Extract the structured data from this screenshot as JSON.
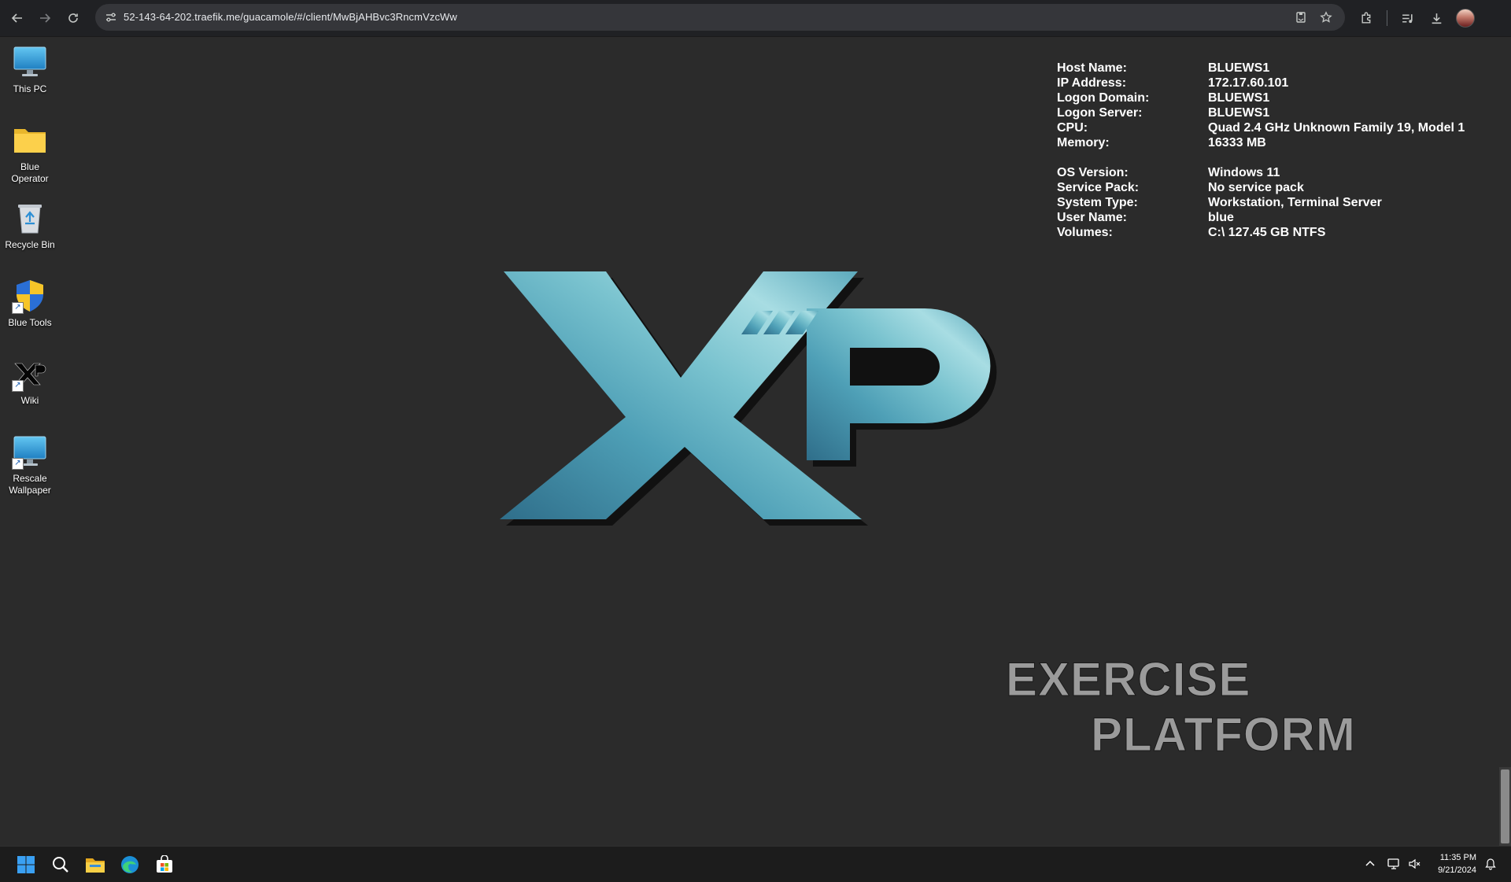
{
  "browser": {
    "url": "52-143-64-202.traefik.me/guacamole/#/client/MwBjAHBvc3RncmVzcWw",
    "icons": [
      "back-icon",
      "forward-icon",
      "reload-icon",
      "site-info-icon",
      "install-app-icon",
      "bookmark-star-icon",
      "extensions-icon",
      "media-control-icon",
      "downloads-icon",
      "profile-avatar"
    ]
  },
  "desktop": {
    "icons": [
      {
        "label": "This PC"
      },
      {
        "label": "Blue\nOperator"
      },
      {
        "label": "Recycle Bin"
      },
      {
        "label": "Blue Tools"
      },
      {
        "label": "Wiki"
      },
      {
        "label": "Rescale\nWallpaper"
      }
    ]
  },
  "sysinfo": {
    "group1": [
      {
        "key": "Host Name:",
        "value": "BLUEWS1"
      },
      {
        "key": "IP Address:",
        "value": "172.17.60.101"
      },
      {
        "key": "Logon Domain:",
        "value": "BLUEWS1"
      },
      {
        "key": "Logon Server:",
        "value": "BLUEWS1"
      },
      {
        "key": "CPU:",
        "value": "Quad 2.4 GHz Unknown Family 19, Model 1"
      },
      {
        "key": "Memory:",
        "value": "16333 MB"
      }
    ],
    "group2": [
      {
        "key": "OS Version:",
        "value": "Windows 11"
      },
      {
        "key": "Service Pack:",
        "value": "No service pack"
      },
      {
        "key": "System Type:",
        "value": "Workstation, Terminal Server"
      },
      {
        "key": "User Name:",
        "value": "blue"
      },
      {
        "key": "Volumes:",
        "value": "C:\\ 127.45 GB NTFS"
      }
    ]
  },
  "wallpaper": {
    "logo_text": "XP",
    "wordmark_line1": "EXERCISE",
    "wordmark_line2": "PLATFORM"
  },
  "taskbar": {
    "time": "11:35 PM",
    "date": "9/21/2024",
    "icons": [
      "start-icon",
      "search-icon",
      "file-explorer-icon",
      "edge-icon",
      "store-icon",
      "show-hidden-icons-chevron",
      "network-icon",
      "volume-icon",
      "notification-icon"
    ]
  },
  "colors": {
    "desktop_bg": "#2b2b2b",
    "chrome_bg": "#202124",
    "omnibox_bg": "#35363a",
    "logo_teal": "#4aa3b8",
    "wordmark_gray": "#9a9a9a",
    "taskbar_bg": "#1c1c1c"
  }
}
